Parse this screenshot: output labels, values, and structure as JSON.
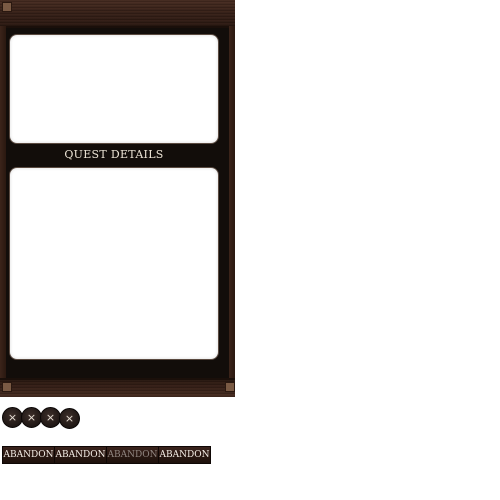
{
  "quest_window": {
    "details_title": "QUEST DETAILS"
  },
  "close_buttons": [
    {
      "label": "×",
      "icon": "close-icon"
    },
    {
      "label": "×",
      "icon": "close-icon"
    },
    {
      "label": "×",
      "icon": "close-icon"
    },
    {
      "label": "×",
      "icon": "close-icon"
    }
  ],
  "abandon_buttons": [
    {
      "label": "ABANDON",
      "state": "normal"
    },
    {
      "label": "ABANDON",
      "state": "normal"
    },
    {
      "label": "ABANDON",
      "state": "disabled"
    },
    {
      "label": "ABANDON",
      "state": "normal"
    }
  ],
  "colors": {
    "wood": "#3a2219",
    "frame_dark": "#120d0a",
    "button_text": "#f3ede6",
    "button_text_disabled": "#8f8580"
  }
}
